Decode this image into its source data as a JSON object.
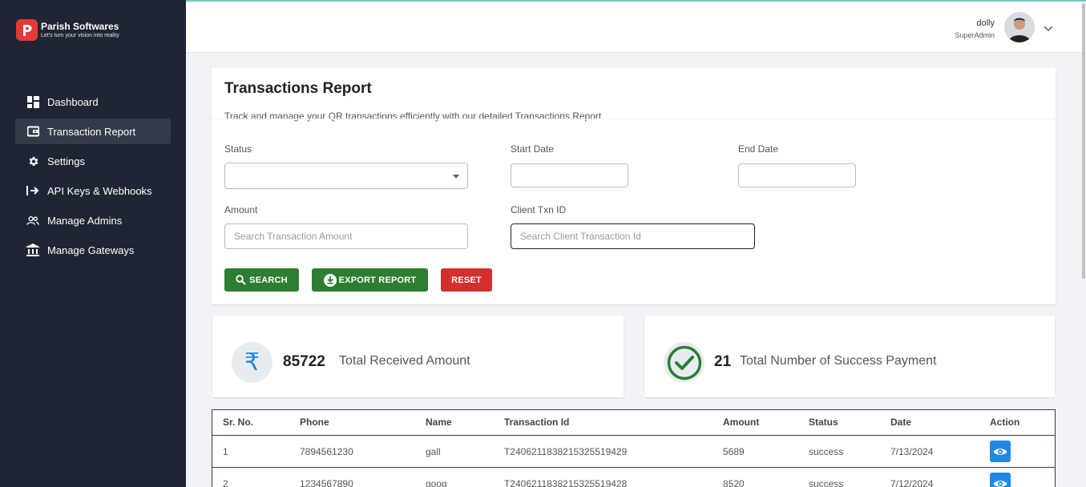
{
  "brand": {
    "name": "Parish Softwares",
    "tagline": "Let's turn your vision into reality"
  },
  "sidebar": {
    "items": [
      {
        "label": "Dashboard",
        "icon": "dashboard-icon",
        "active": false
      },
      {
        "label": "Transaction Report",
        "icon": "wallet-icon",
        "active": true
      },
      {
        "label": "Settings",
        "icon": "gear-icon",
        "active": false
      },
      {
        "label": "API Keys & Webhooks",
        "icon": "login-arrow-icon",
        "active": false
      },
      {
        "label": "Manage Admins",
        "icon": "users-icon",
        "active": false
      },
      {
        "label": "Manage Gateways",
        "icon": "bank-icon",
        "active": false
      }
    ]
  },
  "header": {
    "user_name": "dolly",
    "user_role": "SuperAdmin"
  },
  "report": {
    "title": "Transactions Report",
    "subtitle": "Track and manage your QR transactions efficiently with our detailed Transactions Report"
  },
  "filters": {
    "status_label": "Status",
    "status_value": "",
    "start_date_label": "Start Date",
    "start_date_value": "",
    "end_date_label": "End Date",
    "end_date_value": "",
    "amount_label": "Amount",
    "amount_placeholder": "Search Transaction Amount",
    "client_txn_label": "Client Txn ID",
    "client_txn_placeholder": "Search Client Transaction Id"
  },
  "buttons": {
    "search": "SEARCH",
    "export": "EXPORT REPORT",
    "reset": "RESET"
  },
  "stats": {
    "received_value": "85722",
    "received_label": "Total Received Amount",
    "success_value": "21",
    "success_label": "Total Number of Success Payment"
  },
  "table": {
    "headers": [
      "Sr. No.",
      "Phone",
      "Name",
      "Transaction Id",
      "Amount",
      "Status",
      "Date",
      "Action"
    ],
    "rows": [
      [
        "1",
        "7894561230",
        "gall",
        "T2406211838215325519429",
        "5689",
        "success",
        "7/13/2024"
      ],
      [
        "2",
        "1234567890",
        "goog",
        "T2406211838215325519428",
        "8520",
        "success",
        "7/12/2024"
      ]
    ]
  },
  "colors": {
    "sidebar_bg": "#1f2532",
    "active_item_bg": "#343b48",
    "primary_green": "#2e7d32",
    "reset_red": "#d32f2f",
    "action_blue": "#1e88e5"
  }
}
